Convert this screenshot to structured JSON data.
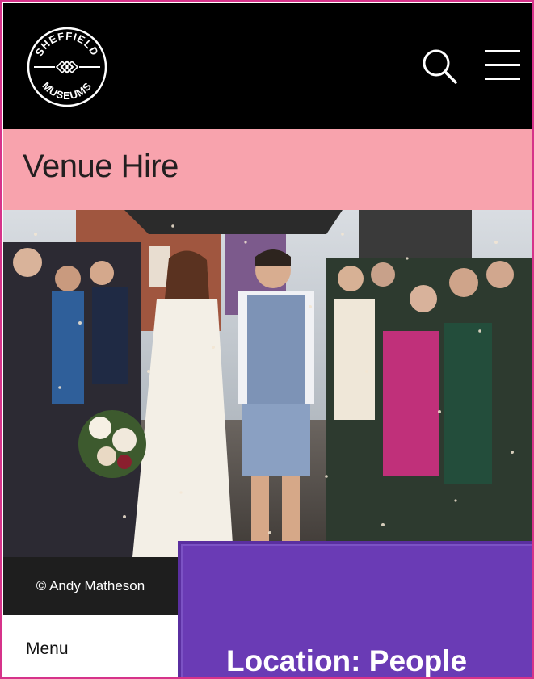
{
  "header": {
    "logo_text_top": "SHEFFIELD",
    "logo_text_bottom": "MUSEUMS",
    "search_icon": "search-icon",
    "menu_icon": "hamburger-menu-icon"
  },
  "page": {
    "title": "Venue Hire"
  },
  "hero": {
    "credit": "© Andy Matheson"
  },
  "sidebar": {
    "menu_label": "Menu"
  },
  "location": {
    "heading": "Location: People"
  },
  "colors": {
    "header_bg": "#000000",
    "title_band": "#f8a3ad",
    "location_panel": "#6a3bb5",
    "credit_bg": "#1e1e1e",
    "frame_border": "#d6338a"
  }
}
